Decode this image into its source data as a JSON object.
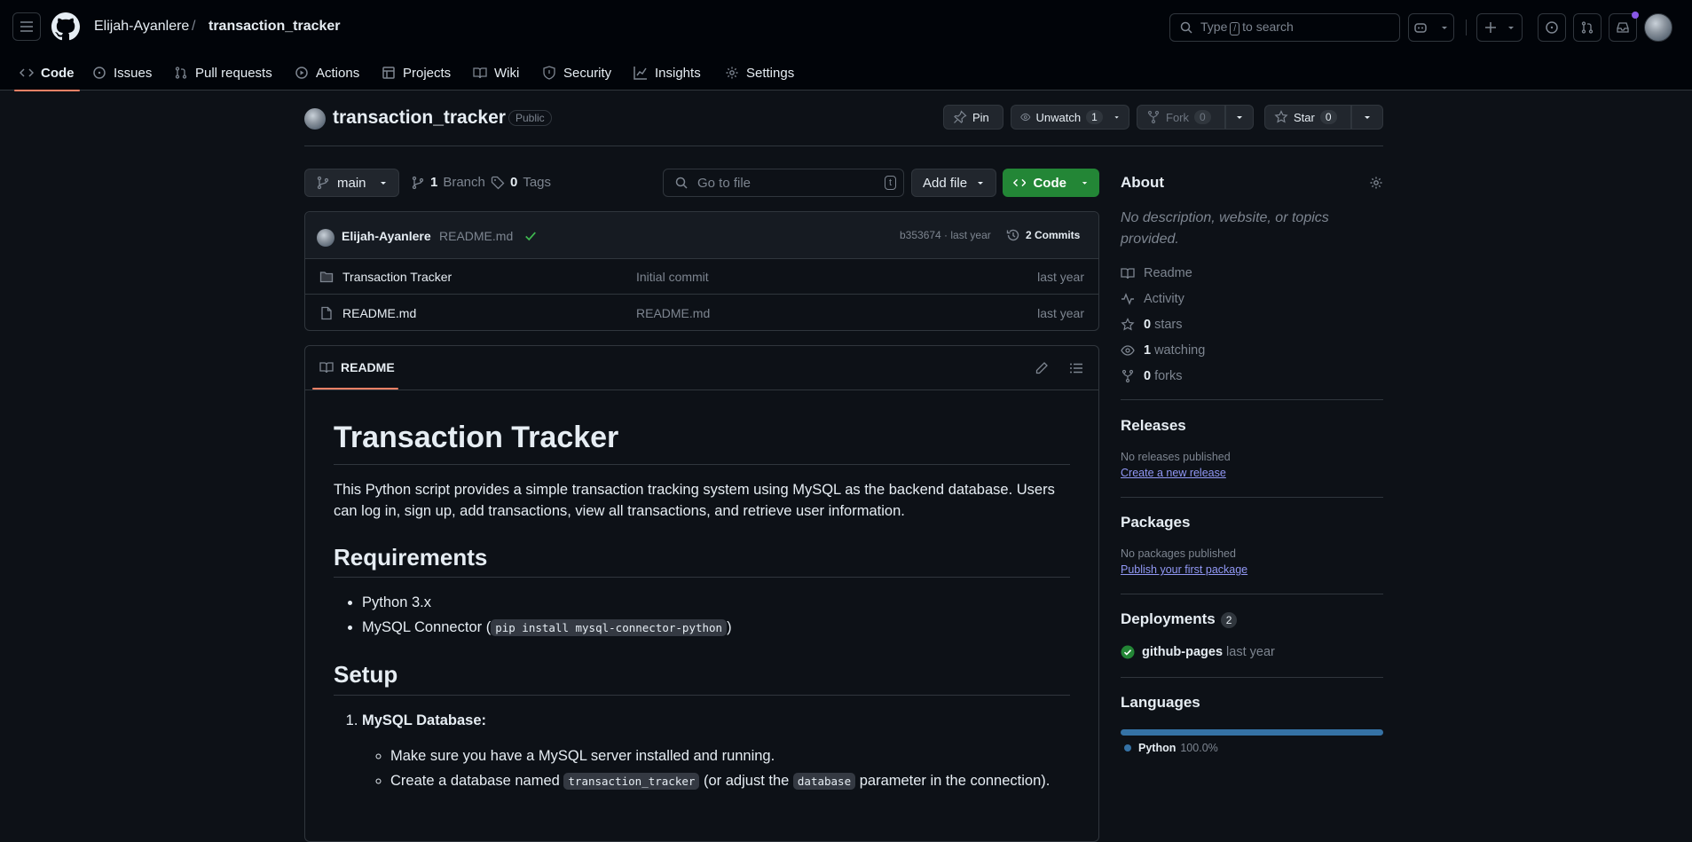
{
  "header": {
    "owner": "Elijah-Ayanlere",
    "separator": "/",
    "repo": "transaction_tracker",
    "search_prefix": "Type",
    "search_key": "/",
    "search_suffix": "to search"
  },
  "tabs": [
    {
      "label": "Code",
      "icon": "code-icon"
    },
    {
      "label": "Issues",
      "icon": "issue-icon"
    },
    {
      "label": "Pull requests",
      "icon": "pull-request-icon"
    },
    {
      "label": "Actions",
      "icon": "play-icon"
    },
    {
      "label": "Projects",
      "icon": "table-icon"
    },
    {
      "label": "Wiki",
      "icon": "book-icon"
    },
    {
      "label": "Security",
      "icon": "shield-icon"
    },
    {
      "label": "Insights",
      "icon": "graph-icon"
    },
    {
      "label": "Settings",
      "icon": "gear-icon"
    }
  ],
  "repo_head": {
    "title": "transaction_tracker",
    "visibility": "Public",
    "pin_label": "Pin",
    "unwatch_label": "Unwatch",
    "unwatch_count": "1",
    "fork_label": "Fork",
    "fork_count": "0",
    "star_label": "Star",
    "star_count": "0"
  },
  "file_nav": {
    "branch": "main",
    "branch_count": "1",
    "branch_label": "Branch",
    "tag_count": "0",
    "tag_label": "Tags",
    "goto_placeholder": "Go to file",
    "goto_key": "t",
    "add_file_label": "Add file",
    "code_label": "Code"
  },
  "latest_commit": {
    "author": "Elijah-Ayanlere",
    "message": "README.md",
    "hash_time": "b353674 · last year",
    "commits_label": "2 Commits"
  },
  "files": [
    {
      "name": "Transaction Tracker",
      "type": "folder",
      "commit": "Initial commit",
      "time": "last year"
    },
    {
      "name": "README.md",
      "type": "file",
      "commit": "README.md",
      "time": "last year"
    }
  ],
  "readme": {
    "tab_label": "README",
    "h1": "Transaction Tracker",
    "intro": "This Python script provides a simple transaction tracking system using MySQL as the backend database. Users can log in, sign up, add transactions, view all transactions, and retrieve user information.",
    "h2_requirements": "Requirements",
    "req_1": "Python 3.x",
    "req_2_text": "MySQL Connector (",
    "req_2_code": "pip install mysql-connector-python",
    "req_2_end": ")",
    "h2_setup": "Setup",
    "setup_1_title": "MySQL Database:",
    "setup_1_a": "Make sure you have a MySQL server installed and running.",
    "setup_1_b_pre": "Create a database named",
    "setup_1_b_code1": "transaction_tracker",
    "setup_1_b_mid": "(or adjust the",
    "setup_1_b_code2": "database",
    "setup_1_b_post": "parameter in the connection)."
  },
  "about": {
    "title": "About",
    "description": "No description, website, or topics provided.",
    "readme": "Readme",
    "activity": "Activity",
    "stars_count": "0",
    "stars_label": "stars",
    "watching_count": "1",
    "watching_label": "watching",
    "forks_count": "0",
    "forks_label": "forks"
  },
  "releases": {
    "title": "Releases",
    "empty": "No releases published",
    "link": "Create a new release"
  },
  "packages": {
    "title": "Packages",
    "empty": "No packages published",
    "link": "Publish your first package"
  },
  "deployments": {
    "title": "Deployments",
    "count": "2",
    "env": "github-pages",
    "time": "last year"
  },
  "languages": {
    "title": "Languages",
    "name": "Python",
    "percent": "100.0%",
    "color": "#3572A5",
    "share": 1.0
  },
  "colors": {
    "accent_tab": "#f78166",
    "code_button": "#238636",
    "link": "#9198f5",
    "success": "#3fb950"
  }
}
